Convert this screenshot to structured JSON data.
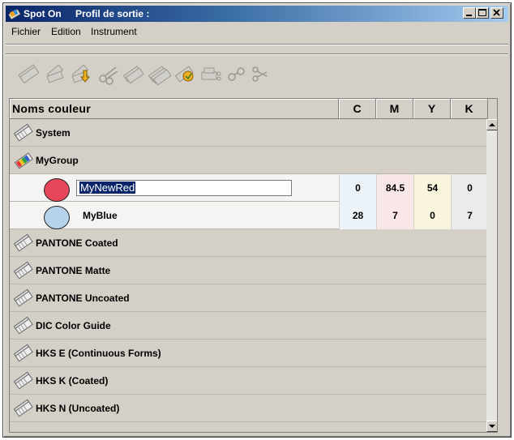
{
  "window": {
    "app_name": "Spot On",
    "profile_label": "Profil de sortie :"
  },
  "menu": [
    "Fichier",
    "Edition",
    "Instrument"
  ],
  "toolbar": {
    "icons": [
      "new-library-icon",
      "new-group-icon",
      "import-icon",
      "cut-icon",
      "copy-icon",
      "paste-icon",
      "edit-icon",
      "print-icon",
      "measure-icon",
      "link-icon"
    ]
  },
  "table": {
    "headers": {
      "name": "Noms couleur",
      "c": "C",
      "m": "M",
      "y": "Y",
      "k": "K"
    },
    "rows": [
      {
        "type": "library",
        "label": "System"
      },
      {
        "type": "group",
        "label": "MyGroup"
      },
      {
        "type": "color",
        "label": "MyNewRed",
        "editing": true,
        "swatch": "#e8465a",
        "c": "0",
        "m": "84.5",
        "y": "54",
        "k": "0"
      },
      {
        "type": "color",
        "label": "MyBlue",
        "editing": false,
        "swatch": "#b7d3ec",
        "c": "28",
        "m": "7",
        "y": "0",
        "k": "7"
      },
      {
        "type": "library",
        "label": "PANTONE Coated"
      },
      {
        "type": "library",
        "label": "PANTONE Matte"
      },
      {
        "type": "library",
        "label": "PANTONE Uncoated"
      },
      {
        "type": "library",
        "label": "DIC Color Guide"
      },
      {
        "type": "library",
        "label": "HKS E (Continuous Forms)"
      },
      {
        "type": "library",
        "label": "HKS K (Coated)"
      },
      {
        "type": "library",
        "label": "HKS N (Uncoated)"
      }
    ]
  },
  "colors": {
    "titlebar_start": "#0a246a",
    "titlebar_end": "#a6caf0",
    "selection": "#0a246a"
  }
}
